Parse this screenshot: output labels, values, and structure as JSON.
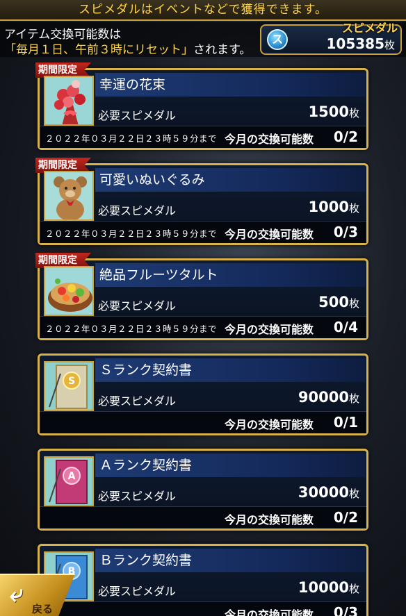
{
  "banner": "スピメダルはイベントなどで獲得できます。",
  "info": {
    "line1": "アイテム交換可能数は",
    "line2_quoted": "「毎月１日、午前３時にリセット」",
    "line2_tail": "されます。"
  },
  "medal": {
    "title": "スピメダル",
    "icon_letter": "ス",
    "count": "105385",
    "unit": "枚"
  },
  "common": {
    "req_label": "必要スピメダル",
    "limit_label": "今月の交換可能数",
    "unit": "枚",
    "ribbon": "期間限定"
  },
  "items": [
    {
      "name": "幸運の花束",
      "icon": "bouquet-icon",
      "cost": "1500",
      "deadline": "２０２２年０３月２２日２３時５９分まで",
      "limit": "0/2",
      "limited": true
    },
    {
      "name": "可愛いぬいぐるみ",
      "icon": "teddy-bear-icon",
      "cost": "1000",
      "deadline": "２０２２年０３月２２日２３時５９分まで",
      "limit": "0/3",
      "limited": true
    },
    {
      "name": "絶品フルーツタルト",
      "icon": "fruit-tart-icon",
      "cost": "500",
      "deadline": "２０２２年０３月２２日２３時５９分まで",
      "limit": "0/4",
      "limited": true
    },
    {
      "name": "Ｓランク契約書",
      "icon": "s-rank-contract-icon",
      "cost": "90000",
      "deadline": "",
      "limit": "0/1",
      "limited": false
    },
    {
      "name": "Ａランク契約書",
      "icon": "a-rank-contract-icon",
      "cost": "30000",
      "deadline": "",
      "limit": "0/2",
      "limited": false
    },
    {
      "name": "Ｂランク契約書",
      "icon": "b-rank-contract-icon",
      "cost": "10000",
      "deadline": "",
      "limit": "0/3",
      "limited": false
    }
  ],
  "back_button": "戻る"
}
